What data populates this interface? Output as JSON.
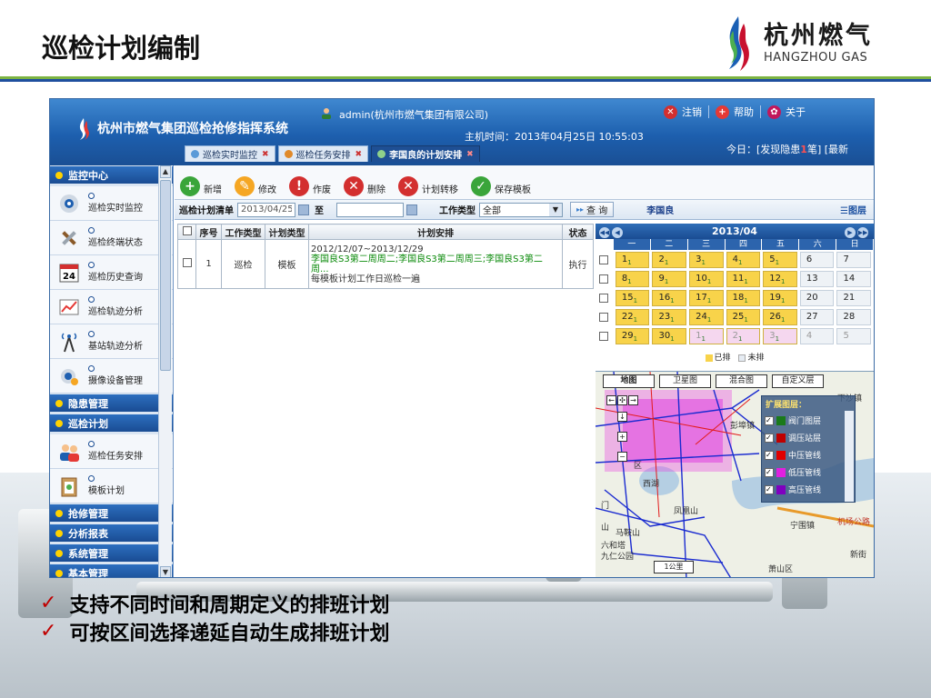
{
  "slide": {
    "title": "巡检计划编制",
    "logo_cn": "杭州燃气",
    "logo_en": "HANGZHOU GAS",
    "bullets": [
      "支持不同时间和周期定义的排班计划",
      "可按区间选择递延自动生成排班计划"
    ]
  },
  "app": {
    "title": "杭州市燃气集团巡检抢修指挥系统",
    "user": "admin(杭州市燃气集团有限公司)",
    "host_time": "主机时间：2013年04月25日 10:55:03",
    "top_buttons": {
      "logout": "注销",
      "help": "帮助",
      "about": "关于"
    },
    "tabs": [
      "巡检实时监控",
      "巡检任务安排",
      "李国良的计划安排"
    ],
    "today_prefix": "今日：[发现隐患",
    "today_count": "1",
    "today_suffix": "笔] [最新",
    "colors": {
      "header": "#1d5fae",
      "accent_yellow": "#f8d34a",
      "sidebar_head": "#1a4c93"
    }
  },
  "sidebar": {
    "sections": [
      {
        "label": "监控中心",
        "items": [
          {
            "label": "巡检实时监控",
            "icon": "camera-icon"
          },
          {
            "label": "巡检终端状态",
            "icon": "tools-icon"
          },
          {
            "label": "巡检历史查询",
            "icon": "calendar-24-icon"
          },
          {
            "label": "巡检轨迹分析",
            "icon": "chart-icon"
          },
          {
            "label": "基站轨迹分析",
            "icon": "antenna-icon"
          },
          {
            "label": "摄像设备管理",
            "icon": "camera-manage-icon"
          }
        ]
      },
      {
        "label": "隐患管理"
      },
      {
        "label": "巡检计划",
        "items": [
          {
            "label": "巡检任务安排",
            "icon": "people-icon"
          },
          {
            "label": "模板计划",
            "icon": "clipboard-icon"
          }
        ]
      },
      {
        "label": "抢修管理"
      },
      {
        "label": "分析报表"
      },
      {
        "label": "系统管理"
      },
      {
        "label": "基本管理"
      }
    ]
  },
  "toolbar": {
    "new": "新增",
    "edit": "修改",
    "void": "作废",
    "delete": "删除",
    "transfer": "计划转移",
    "save_template": "保存模板"
  },
  "filter": {
    "label": "巡检计划清单",
    "date_from": "2013/04/25",
    "to": "至",
    "date_to": "",
    "type_label": "工作类型",
    "type_value": "全部",
    "query": "查 询",
    "person": "李国良",
    "layers": "图层"
  },
  "grid": {
    "headers": [
      "序号",
      "工作类型",
      "计划类型",
      "计划安排",
      "状态"
    ],
    "rows": [
      {
        "no": "1",
        "work_type": "巡检",
        "plan_type": "模板",
        "date": "2012/12/07~2013/12/29",
        "schedule": "李国良S3第二周周二;李国良S3第二周周三;李国良S3第二周...",
        "note": "每模板计划工作日巡检一遍",
        "status": "执行"
      }
    ]
  },
  "calendar": {
    "month": "2013/04",
    "weekdays": [
      "一",
      "二",
      "三",
      "四",
      "五",
      "六",
      "日"
    ],
    "weeks": [
      [
        {
          "d": "1",
          "c": "1"
        },
        {
          "d": "2",
          "c": "1"
        },
        {
          "d": "3",
          "c": "1"
        },
        {
          "d": "4",
          "c": "1"
        },
        {
          "d": "5",
          "c": "1"
        },
        {
          "d": "6",
          "c": ""
        },
        {
          "d": "7",
          "c": ""
        }
      ],
      [
        {
          "d": "8",
          "c": "1"
        },
        {
          "d": "9",
          "c": "1"
        },
        {
          "d": "10",
          "c": "1"
        },
        {
          "d": "11",
          "c": "1"
        },
        {
          "d": "12",
          "c": "1"
        },
        {
          "d": "13",
          "c": ""
        },
        {
          "d": "14",
          "c": ""
        }
      ],
      [
        {
          "d": "15",
          "c": "1"
        },
        {
          "d": "16",
          "c": "1"
        },
        {
          "d": "17",
          "c": "1"
        },
        {
          "d": "18",
          "c": "1"
        },
        {
          "d": "19",
          "c": "1"
        },
        {
          "d": "20",
          "c": ""
        },
        {
          "d": "21",
          "c": ""
        }
      ],
      [
        {
          "d": "22",
          "c": "1"
        },
        {
          "d": "23",
          "c": "1"
        },
        {
          "d": "24",
          "c": "1"
        },
        {
          "d": "25",
          "c": "1"
        },
        {
          "d": "26",
          "c": "1"
        },
        {
          "d": "27",
          "c": ""
        },
        {
          "d": "28",
          "c": ""
        }
      ],
      [
        {
          "d": "29",
          "c": "1"
        },
        {
          "d": "30",
          "c": "1"
        },
        {
          "d": "1",
          "c": "1"
        },
        {
          "d": "2",
          "c": "1"
        },
        {
          "d": "3",
          "c": "1"
        },
        {
          "d": "4",
          "c": ""
        },
        {
          "d": "5",
          "c": ""
        }
      ]
    ],
    "legend_scheduled": "已排",
    "legend_unscheduled": "未排"
  },
  "map": {
    "tabs": [
      "地图",
      "卫星图",
      "混合图",
      "自定义层"
    ],
    "layer_title": "扩展图层：",
    "layers": [
      {
        "label": "阀门图层",
        "color": "#1a7a1a"
      },
      {
        "label": "调压站层",
        "color": "#c00000"
      },
      {
        "label": "中压管线",
        "color": "#e00000"
      },
      {
        "label": "低压管线",
        "color": "#e020e0"
      },
      {
        "label": "高压管线",
        "color": "#8000c0"
      }
    ],
    "labels": [
      "西湖",
      "凤凰山",
      "马鞍山",
      "宁围镇",
      "机场公路",
      "新街",
      "萧山区",
      "下沙镇",
      "六和塔",
      "九仁公园",
      "区",
      "彭埠镇",
      "山",
      "门"
    ],
    "scale": "1公里"
  }
}
